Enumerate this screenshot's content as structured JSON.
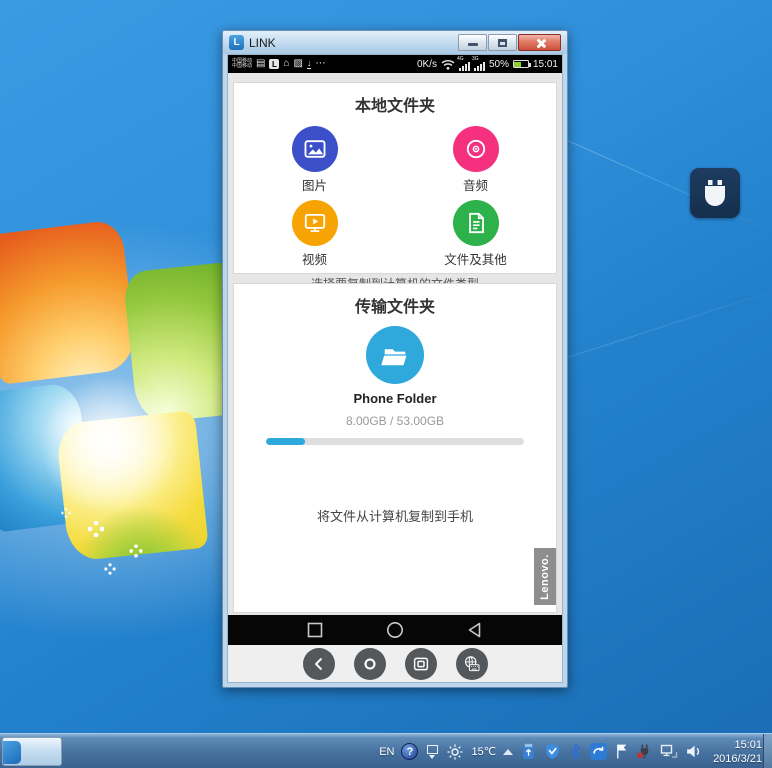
{
  "window": {
    "title": "LINK",
    "app_initial": "L"
  },
  "phone_status": {
    "carrier_top": "中国移动",
    "carrier_bottom": "中国移动",
    "link_initial": "L",
    "more": "⋯",
    "speed": "0K/s",
    "signal_a_label": "4G",
    "signal_b_label": "3G",
    "battery_percent": "50%",
    "time": "15:01"
  },
  "local_folders": {
    "title": "本地文件夹",
    "caption": "选择要复制到计算机的文件类型",
    "items": [
      {
        "label": "图片",
        "color": "#3a4fc8",
        "icon": "picture-icon"
      },
      {
        "label": "音频",
        "color": "#f5317f",
        "icon": "audio-disc-icon"
      },
      {
        "label": "视频",
        "color": "#f7a302",
        "icon": "video-screen-icon"
      },
      {
        "label": "文件及其他",
        "color": "#2db14a",
        "icon": "document-icon"
      }
    ]
  },
  "transfer_folder": {
    "title": "传输文件夹",
    "accent_color": "#2fa8dc",
    "folder_name": "Phone Folder",
    "usage": "8.00GB / 53.00GB",
    "used_gb": 8.0,
    "total_gb": 53.0,
    "progress_percent": 15,
    "hint": "将文件从计算机复制到手机",
    "brand_badge": "Lenovo."
  },
  "taskbar": {
    "language": "EN",
    "help": "?",
    "temperature": "15℃",
    "clock": {
      "time": "15:01",
      "date": "2016/3/21"
    }
  }
}
